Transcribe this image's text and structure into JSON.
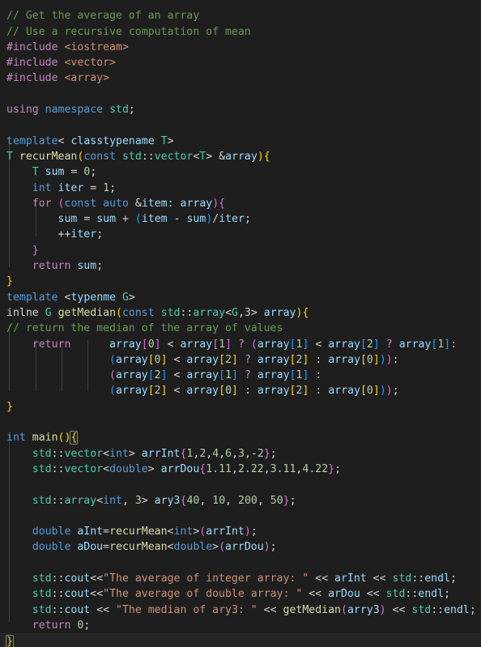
{
  "editor": {
    "language": "cpp",
    "theme": "Dark+ (default dark)",
    "background_color": "#1e1e1e",
    "foreground_color": "#d4d4d4",
    "font_size_px": 13,
    "line_height_px": 19,
    "indent_guide_color": "#404040",
    "current_line_background": "#232323",
    "bracket_match_border": "#888888",
    "token_colors": {
      "comment": "#6a9955",
      "preprocessor": "#c586c0",
      "string": "#ce9178",
      "keyword": "#569cd6",
      "control": "#c586c0",
      "type": "#4ec9b0",
      "variable": "#9cdcfe",
      "function": "#dcdcaa",
      "number": "#b5cea8",
      "bracket_level_1": "#ffd700",
      "bracket_level_2": "#da70d6",
      "bracket_level_3": "#179fff"
    }
  },
  "code": {
    "line_01_clipped": "",
    "line_02_comment_average": "// Get the average of an array",
    "line_03_comment_recursive": "// Use a recursive computation of mean",
    "line_04_include_iostream": "#include <iostream>",
    "line_05_include_vector": "#include <vector>",
    "line_06_include_array": "#include <array>",
    "line_07_blank": "",
    "line_08_using_namespace": "using namespace std;",
    "line_09_blank": "",
    "line_10_template_t": "template< classtypename T>",
    "line_11_recurmean_sig": "T recurMean(const std::vector<T> &array){",
    "line_12_sum_init": "    T sum = 0;",
    "line_13_iter_init": "    int iter = 1;",
    "line_14_for_loop": "    for (const auto &item: array){",
    "line_15_sum_update": "        sum = sum + (item - sum)/iter;",
    "line_16_iter_incr": "        ++iter;",
    "line_17_close_for": "    }",
    "line_18_return_sum": "    return sum;",
    "line_19_close_func": "}",
    "line_20_template_g": "template <typenme G>",
    "line_21_getmedian_sig": "inlne G getMedian(const std::array<G,3> array){",
    "line_22_comment_median": "// return the median of the array of values",
    "line_23_return_ternary_1": "    return      array[0] < array[1] ? (array[1] < array[2] ? array[1]:",
    "line_24_return_ternary_2": "                (array[0] < array[2] ? array[2] : array[0])):",
    "line_25_return_ternary_3": "                (array[2] < array[1] ? array[1] :",
    "line_26_return_ternary_4": "                (array[2] < array[0] : array[2] : array[0]));",
    "line_27_close_getmedian": "}",
    "line_28_blank": "",
    "line_29_main_sig": "int main(){",
    "line_30_arrint": "    std::vector<int> arrInt{1,2,4,6,3,-2};",
    "line_31_arrdou": "    std::vector<double> arrDou{1.11,2.22,3.11,4.22};",
    "line_32_blank": "",
    "line_33_ary3": "    std::array<int, 3> ary3{40, 10, 200, 50};",
    "line_34_blank": "",
    "line_35_aint": "    double aInt=recurMean<int>(arrInt);",
    "line_36_adou": "    double aDou=recurMean<double>(arrDou);",
    "line_37_blank": "",
    "line_38_cout_int": "    std::cout<<\"The average of integer array: \" << arInt << std::endl;",
    "line_39_cout_dou": "    std::cout<<\"The average of double array: \" << arDou << std::endl;",
    "line_40_cout_median": "    std::cout << \"The median of ary3: \" << getMedian(arry3) << std::endl;",
    "line_41_return_zero": "    return 0;",
    "line_42_close_main": "}"
  },
  "strings": {
    "average_integer": "\"The average of integer array: \"",
    "average_double": "\"The average of double array: \"",
    "median_ary3": "\"The median of ary3: \""
  },
  "values": {
    "arrInt_elements": [
      1,
      2,
      4,
      6,
      3,
      -2
    ],
    "arrDou_elements": [
      1.11,
      2.22,
      3.11,
      4.22
    ],
    "ary3_elements": [
      40,
      10,
      200,
      50
    ],
    "ary3_size": 3,
    "sum_init": 0,
    "iter_init": 1,
    "return_value": 0
  }
}
